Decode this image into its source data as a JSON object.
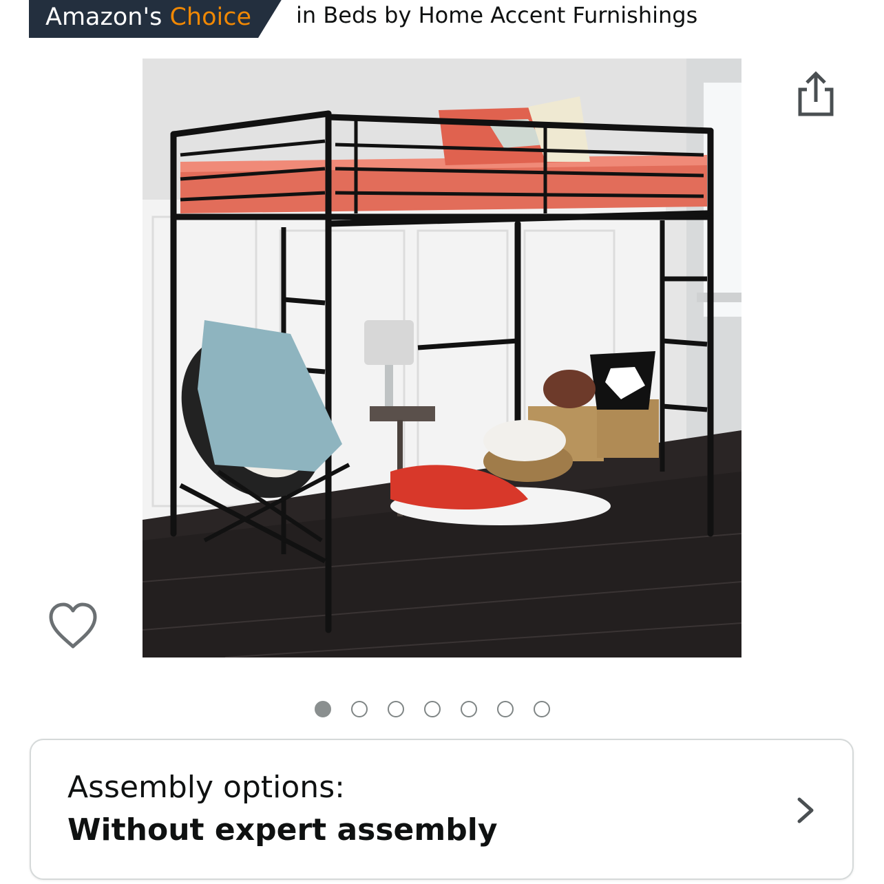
{
  "badge": {
    "prefix": "Amazon's",
    "accent": "Choice",
    "context": "in Beds by Home Accent Furnishings",
    "colors": {
      "background": "#232f3e",
      "accent": "#f08804"
    }
  },
  "product": {
    "image_icon": "loft-bed-photo",
    "share_icon": "share-icon",
    "wishlist_icon": "heart-outline-icon"
  },
  "carousel": {
    "total": 7,
    "active_index": 0
  },
  "assembly": {
    "label": "Assembly options:",
    "value": "Without expert assembly",
    "chevron_icon": "chevron-right-icon"
  }
}
